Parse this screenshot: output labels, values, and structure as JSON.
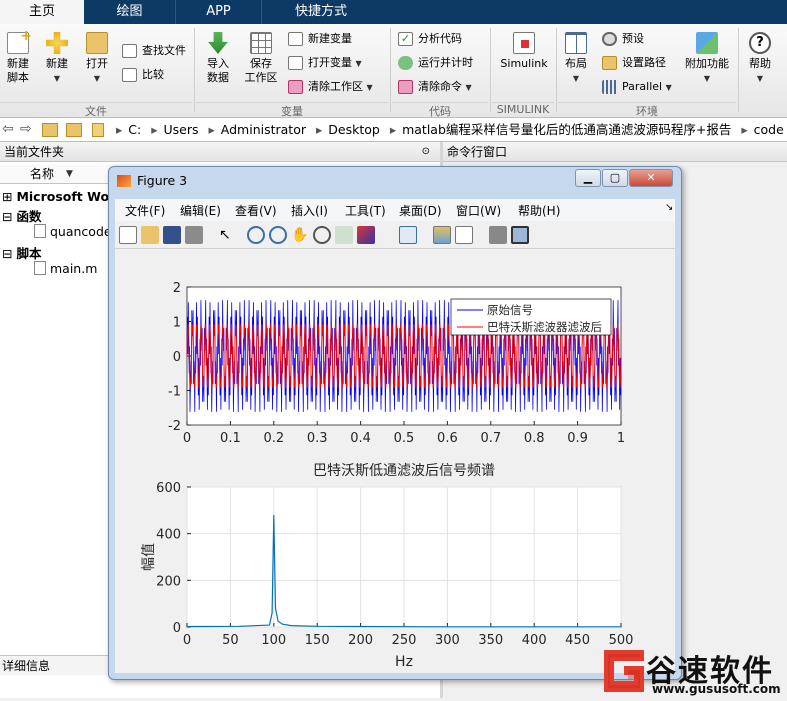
{
  "tabs": [
    "主页",
    "绘图",
    "APP",
    "快捷方式"
  ],
  "ribbon": {
    "file": {
      "new_script": "新建\n脚本",
      "new": "新建",
      "open": "打开",
      "find_files": "查找文件",
      "compare": "比较",
      "group": "文件"
    },
    "variable": {
      "import": "导入\n数据",
      "save_ws": "保存\n工作区",
      "new_var": "新建变量",
      "open_var": "打开变量",
      "clear_ws": "清除工作区",
      "group": "变量"
    },
    "code": {
      "analyze": "分析代码",
      "run_time": "运行并计时",
      "clear_cmd": "清除命令",
      "group": "代码"
    },
    "simulink": {
      "simulink": "Simulink",
      "group": "SIMULINK"
    },
    "env": {
      "layout": "布局",
      "prefs": "预设",
      "set_path": "设置路径",
      "parallel": "Parallel",
      "addons": "附加功能",
      "group": "环境"
    },
    "help": {
      "help": "帮助"
    }
  },
  "address": {
    "crumbs": [
      "C:",
      "Users",
      "Administrator",
      "Desktop",
      "matlab编程采样信号量化后的低通高通滤波源码程序+报告",
      "code"
    ]
  },
  "current_folder": {
    "title": "当前文件夹",
    "col_name": "名称",
    "items": [
      {
        "label": "Microsoft Word",
        "bold": true
      },
      {
        "label": "函数",
        "bold": true
      },
      {
        "label": "quancode",
        "bold": false
      },
      {
        "label": "脚本",
        "bold": true
      },
      {
        "label": "main.m",
        "bold": false
      }
    ]
  },
  "command_window": {
    "title": "命令行窗口"
  },
  "details": {
    "title": "详细信息"
  },
  "figure": {
    "title": "Figure 3",
    "menu": [
      "文件(F)",
      "编辑(E)",
      "查看(V)",
      "插入(I)",
      "工具(T)",
      "桌面(D)",
      "窗口(W)",
      "帮助(H)"
    ]
  },
  "chart_data": [
    {
      "type": "line",
      "title": "",
      "xlim": [
        0,
        1
      ],
      "ylim": [
        -2,
        2
      ],
      "xticks": [
        "0",
        "0.1",
        "0.2",
        "0.3",
        "0.4",
        "0.5",
        "0.6",
        "0.7",
        "0.8",
        "0.9",
        "1"
      ],
      "yticks": [
        "2",
        "1",
        "0",
        "-1",
        "-2"
      ],
      "legend": {
        "position": "top-right",
        "entries": [
          "原始信号",
          "巴特沃斯滤波器滤波后"
        ]
      },
      "series": [
        {
          "name": "原始信号",
          "color": "#0000ff",
          "description_freqs_hz": [
            100,
            380
          ],
          "amplitude": 1.8
        },
        {
          "name": "巴特沃斯滤波器滤波后",
          "color": "#ff0000",
          "frequency_hz": 100,
          "amplitude": 0.95
        }
      ]
    },
    {
      "type": "line",
      "title": "巴特沃斯低通滤波后信号频谱",
      "xlabel": "Hz",
      "ylabel": "幅值",
      "xlim": [
        0,
        500
      ],
      "ylim": [
        0,
        600
      ],
      "xticks": [
        "0",
        "50",
        "100",
        "150",
        "200",
        "250",
        "300",
        "350",
        "400",
        "450",
        "500"
      ],
      "yticks": [
        "600",
        "400",
        "200",
        "0"
      ],
      "series": [
        {
          "color": "#0072bd",
          "x": [
            0,
            20,
            60,
            95,
            98,
            100,
            102,
            105,
            110,
            120,
            150,
            200,
            300,
            400,
            500
          ],
          "y": [
            2,
            2,
            3,
            8,
            60,
            480,
            80,
            25,
            12,
            6,
            3,
            2,
            1,
            1,
            1
          ]
        }
      ]
    }
  ],
  "watermark": {
    "brand": "谷速软件",
    "url": "www.gususoft.com"
  }
}
